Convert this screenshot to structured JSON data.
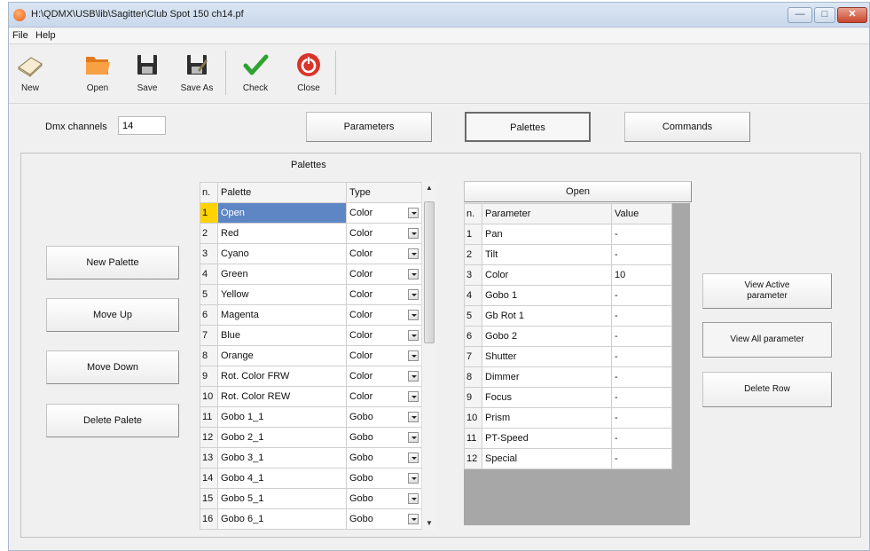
{
  "window": {
    "title": "H:\\QDMX\\USB\\lib\\Sagitter\\Club Spot 150 ch14.pf",
    "controls": {
      "minimize": "—",
      "maximize": "□",
      "close": "✕"
    }
  },
  "menu": {
    "file": "File",
    "help": "Help"
  },
  "toolbar": {
    "new": "New",
    "open": "Open",
    "save": "Save",
    "save_as": "Save As",
    "check": "Check",
    "close": "Close"
  },
  "dmx": {
    "label": "Dmx channels",
    "value": "14"
  },
  "tabs": {
    "parameters": "Parameters",
    "palettes": "Palettes",
    "commands": "Commands"
  },
  "palettes_panel": {
    "title": "Palettes",
    "headers": {
      "n": "n.",
      "palette": "Palette",
      "type": "Type"
    },
    "rows": [
      {
        "n": "1",
        "palette": "Open",
        "type": "Color"
      },
      {
        "n": "2",
        "palette": "Red",
        "type": "Color"
      },
      {
        "n": "3",
        "palette": "Cyano",
        "type": "Color"
      },
      {
        "n": "4",
        "palette": "Green",
        "type": "Color"
      },
      {
        "n": "5",
        "palette": "Yellow",
        "type": "Color"
      },
      {
        "n": "6",
        "palette": "Magenta",
        "type": "Color"
      },
      {
        "n": "7",
        "palette": "Blue",
        "type": "Color"
      },
      {
        "n": "8",
        "palette": "Orange",
        "type": "Color"
      },
      {
        "n": "9",
        "palette": "Rot. Color FRW",
        "type": "Color"
      },
      {
        "n": "10",
        "palette": "Rot. Color REW",
        "type": "Color"
      },
      {
        "n": "11",
        "palette": "Gobo 1_1",
        "type": "Gobo"
      },
      {
        "n": "12",
        "palette": "Gobo 2_1",
        "type": "Gobo"
      },
      {
        "n": "13",
        "palette": "Gobo 3_1",
        "type": "Gobo"
      },
      {
        "n": "14",
        "palette": "Gobo 4_1",
        "type": "Gobo"
      },
      {
        "n": "15",
        "palette": "Gobo 5_1",
        "type": "Gobo"
      },
      {
        "n": "16",
        "palette": "Gobo 6_1",
        "type": "Gobo"
      }
    ],
    "selected_index": 0
  },
  "left_buttons": {
    "new_palette": "New Palette",
    "move_up": "Move Up",
    "move_down": "Move Down",
    "delete_palette": "Delete Palete"
  },
  "params_panel": {
    "title": "Open",
    "headers": {
      "n": "n.",
      "parameter": "Parameter",
      "value": "Value"
    },
    "rows": [
      {
        "n": "1",
        "parameter": "Pan",
        "value": "-"
      },
      {
        "n": "2",
        "parameter": "Tilt",
        "value": "-"
      },
      {
        "n": "3",
        "parameter": "Color",
        "value": "10"
      },
      {
        "n": "4",
        "parameter": "Gobo 1",
        "value": "-"
      },
      {
        "n": "5",
        "parameter": "Gb Rot 1",
        "value": "-"
      },
      {
        "n": "6",
        "parameter": "Gobo 2",
        "value": "-"
      },
      {
        "n": "7",
        "parameter": "Shutter",
        "value": "-"
      },
      {
        "n": "8",
        "parameter": "Dimmer",
        "value": "-"
      },
      {
        "n": "9",
        "parameter": "Focus",
        "value": "-"
      },
      {
        "n": "10",
        "parameter": "Prism",
        "value": "-"
      },
      {
        "n": "11",
        "parameter": "PT-Speed",
        "value": "-"
      },
      {
        "n": "12",
        "parameter": "Special",
        "value": "-"
      }
    ]
  },
  "right_buttons": {
    "view_active": "View Active parameter",
    "view_all": "View All parameter",
    "delete_row": "Delete Row"
  },
  "colors": {
    "selection": "#5e86c4",
    "selected_row_marker": "#ffd200",
    "check_green": "#2fa32f",
    "close_red": "#d9342b",
    "folder_orange": "#f08a24"
  }
}
